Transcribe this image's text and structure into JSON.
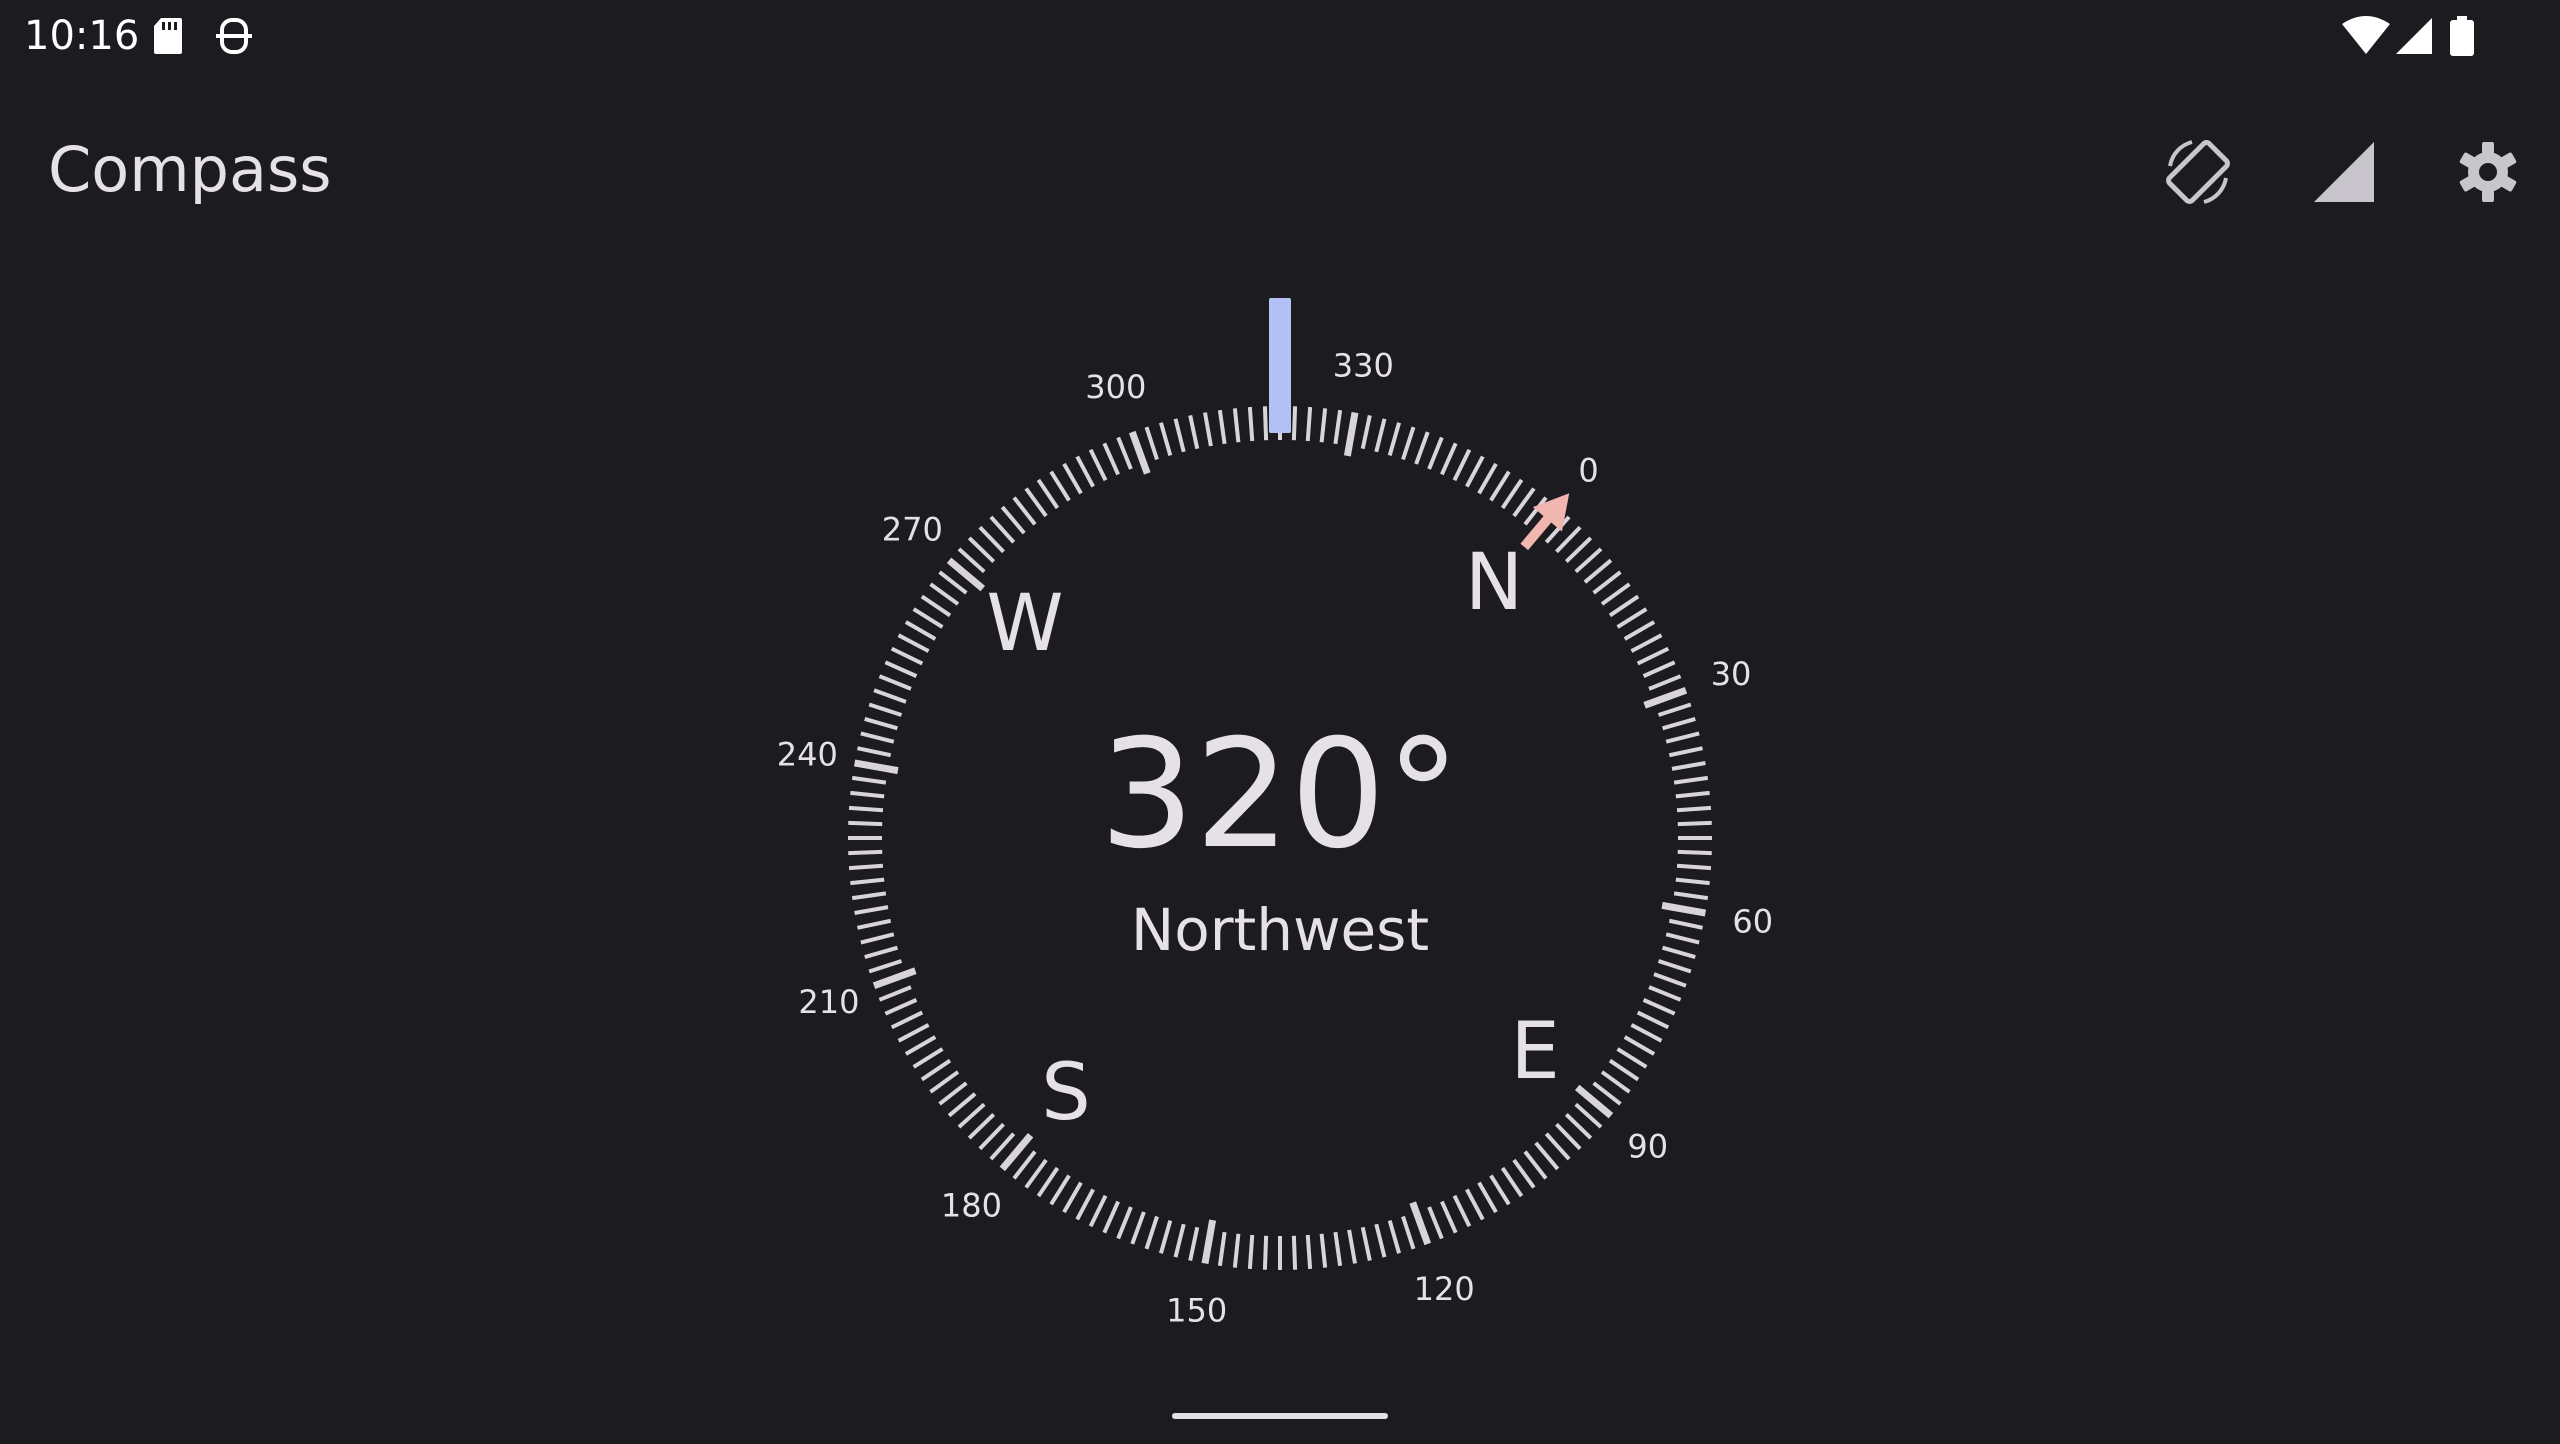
{
  "status_bar": {
    "time": "10:16",
    "left_icons": [
      "sd-card-icon",
      "assistant-icon"
    ],
    "right_icons": [
      "wifi-icon",
      "cellular-signal-icon",
      "battery-icon"
    ]
  },
  "app_bar": {
    "title": "Compass",
    "actions": [
      {
        "name": "screen-rotation-icon"
      },
      {
        "name": "signal-strength-icon"
      },
      {
        "name": "settings-icon"
      }
    ]
  },
  "compass": {
    "heading_degrees": 320,
    "heading_text": "320°",
    "direction_text": "Northwest",
    "cardinals": [
      {
        "label": "N",
        "bearing": 0
      },
      {
        "label": "E",
        "bearing": 90
      },
      {
        "label": "S",
        "bearing": 180
      },
      {
        "label": "W",
        "bearing": 270
      }
    ],
    "degree_labels": [
      "0",
      "30",
      "60",
      "90",
      "120",
      "150",
      "180",
      "210",
      "240",
      "270",
      "300",
      "330"
    ],
    "colors": {
      "heading_indicator": "#b3c0f5",
      "north_arrow": "#f2b6b0",
      "ticks": "#d9d4da"
    }
  }
}
